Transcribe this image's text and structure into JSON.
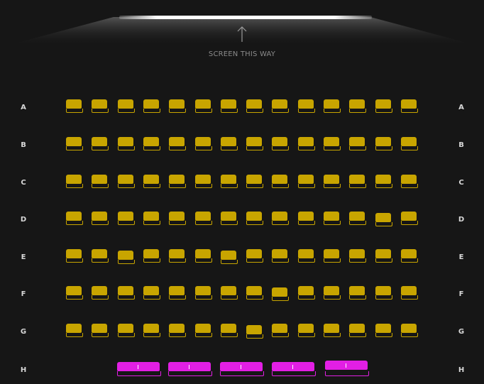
{
  "screen": {
    "label": "SCREEN THIS WAY",
    "direction_icon": "arrow-up-icon"
  },
  "rows": [
    {
      "label": "A",
      "type": "standard",
      "seat_count": 14,
      "status": "available"
    },
    {
      "label": "B",
      "type": "standard",
      "seat_count": 14,
      "status": "available"
    },
    {
      "label": "C",
      "type": "standard",
      "seat_count": 14,
      "status": "available"
    },
    {
      "label": "D",
      "type": "standard",
      "seat_count": 14,
      "status": "available"
    },
    {
      "label": "E",
      "type": "standard",
      "seat_count": 14,
      "status": "available"
    },
    {
      "label": "F",
      "type": "standard",
      "seat_count": 14,
      "status": "available"
    },
    {
      "label": "G",
      "type": "standard",
      "seat_count": 14,
      "status": "available"
    },
    {
      "label": "H",
      "type": "sofa",
      "seat_count": 5,
      "status": "available"
    }
  ],
  "colors": {
    "background": "#161616",
    "standard_seat": "#c8a500",
    "sofa_seat": "#e21fe4",
    "row_label": "#d8d8d8",
    "screen_label": "#8a8a8a"
  }
}
